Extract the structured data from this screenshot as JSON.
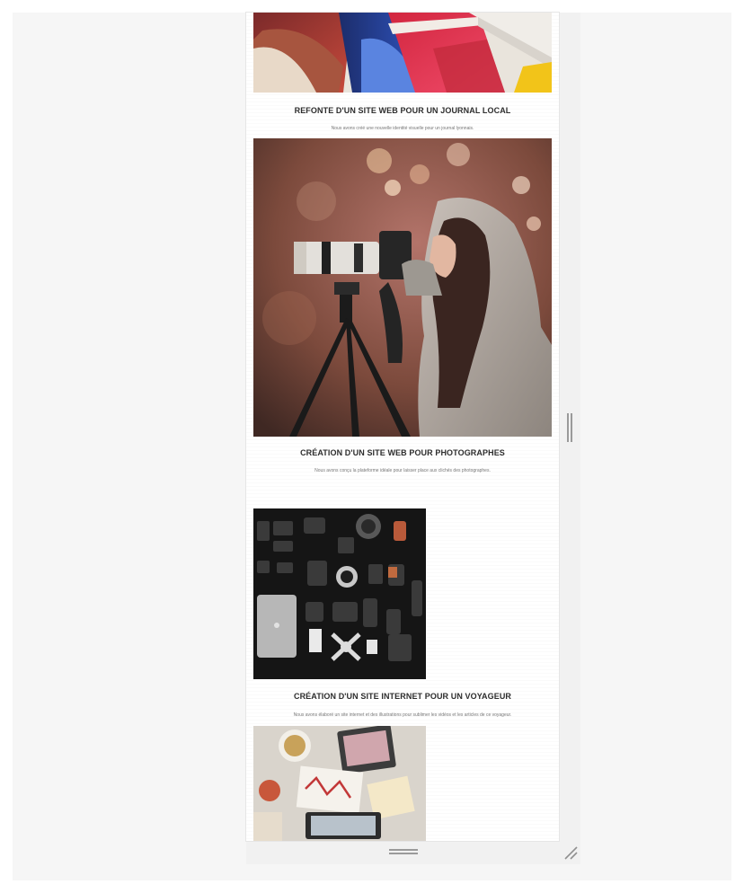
{
  "projects": [
    {
      "title": "REFONTE D'UN SITE WEB POUR UN JOURNAL LOCAL",
      "description": "Nous avons créé une nouvelle identité visuelle pour un journal lyonnais.",
      "image_subject": "magazines-photo"
    },
    {
      "title": "CRÉATION D'UN SITE WEB POUR PHOTOGRAPHES",
      "description": "Nous avons conçu la plateforme idéale pour laisser place aux clichés des photographes.",
      "image_subject": "photographer-photo"
    },
    {
      "title": "CRÉATION D'UN SITE INTERNET POUR UN VOYAGEUR",
      "description": "Nous avons élaboré un site internet et des illustrations pour sublimer les vidéos et les articles de ce voyageur.",
      "image_subject": "camera-gear-photo"
    },
    {
      "title": "",
      "description": "",
      "image_subject": "desk-photo"
    }
  ],
  "colors": {
    "title": "#2d2d2d",
    "description": "#777777",
    "frame_background": "#ffffff",
    "workspace_background": "#f6f6f6"
  },
  "resize_handles": [
    "vertical-resize-handle",
    "horizontal-resize-handle",
    "corner-resize-handle"
  ]
}
